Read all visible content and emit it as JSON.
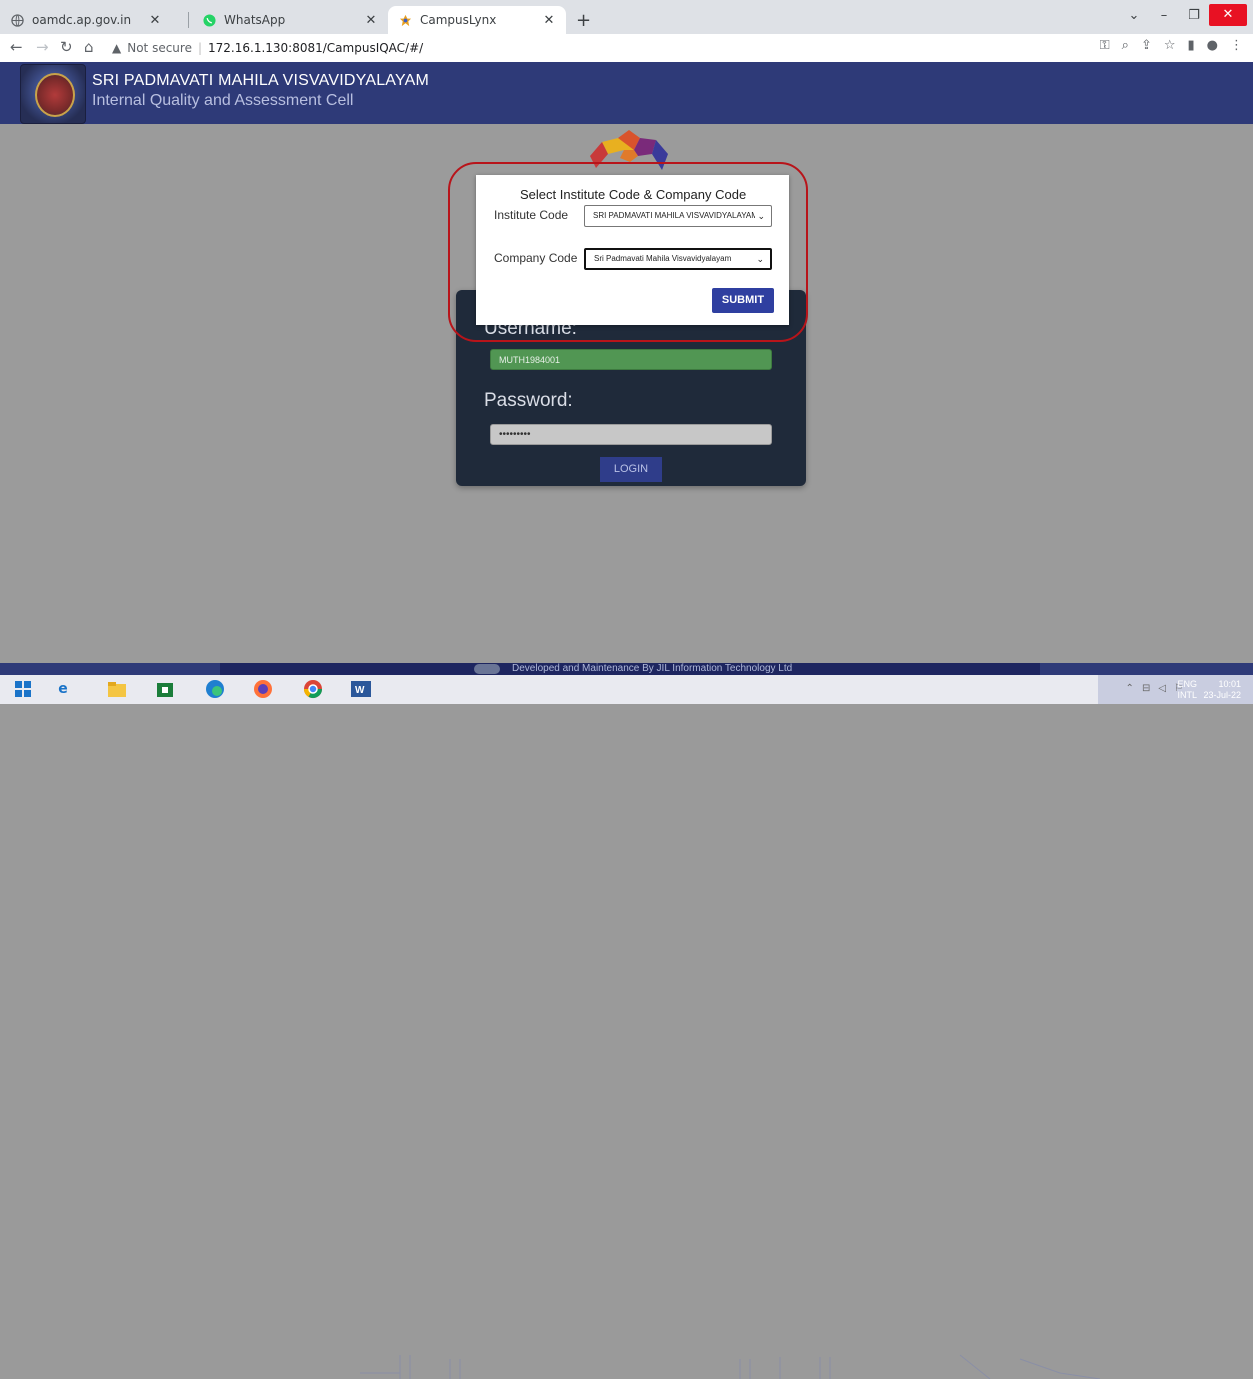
{
  "browser": {
    "tabs": [
      {
        "title": "oamdc.ap.gov.in",
        "icon": "globe-icon",
        "active": false
      },
      {
        "title": "WhatsApp",
        "icon": "whatsapp-icon",
        "active": false
      },
      {
        "title": "CampusLynx",
        "icon": "campuslynx-icon",
        "active": true
      }
    ],
    "new_tab_glyph": "+",
    "address": {
      "security_label": "Not secure",
      "url": "172.16.1.130:8081/CampusIQAC/#/"
    }
  },
  "header": {
    "title": "SRI PADMAVATI MAHILA VISVAVIDYALAYAM",
    "subtitle": "Internal Quality and Assessment Cell"
  },
  "login": {
    "username_label": "Username:",
    "username_value": "MUTH1984001",
    "password_label": "Password:",
    "password_value": "•••••••••",
    "login_button": "LOGIN"
  },
  "modal": {
    "title": "Select Institute Code & Company Code",
    "institute_label": "Institute Code",
    "institute_value": "SRI PADMAVATI MAHILA VISVAVIDYALAYAM",
    "company_label": "Company Code",
    "company_value": "Sri Padmavati Mahila Visvavidyalayam",
    "submit_button": "SUBMIT"
  },
  "footer": {
    "text": "Developed and Maintenance By JIL Information Technology Ltd"
  },
  "taskbar": {
    "lang_top": "ENG",
    "lang_bottom": "INTL",
    "time": "10:01",
    "date": "23-Jul-22"
  },
  "colors": {
    "header_bg": "#2e3a78",
    "login_card_bg": "#1f2a3a",
    "username_field": "#519653",
    "submit_button": "#2f3fa0",
    "highlight_outline": "#b8141a"
  }
}
